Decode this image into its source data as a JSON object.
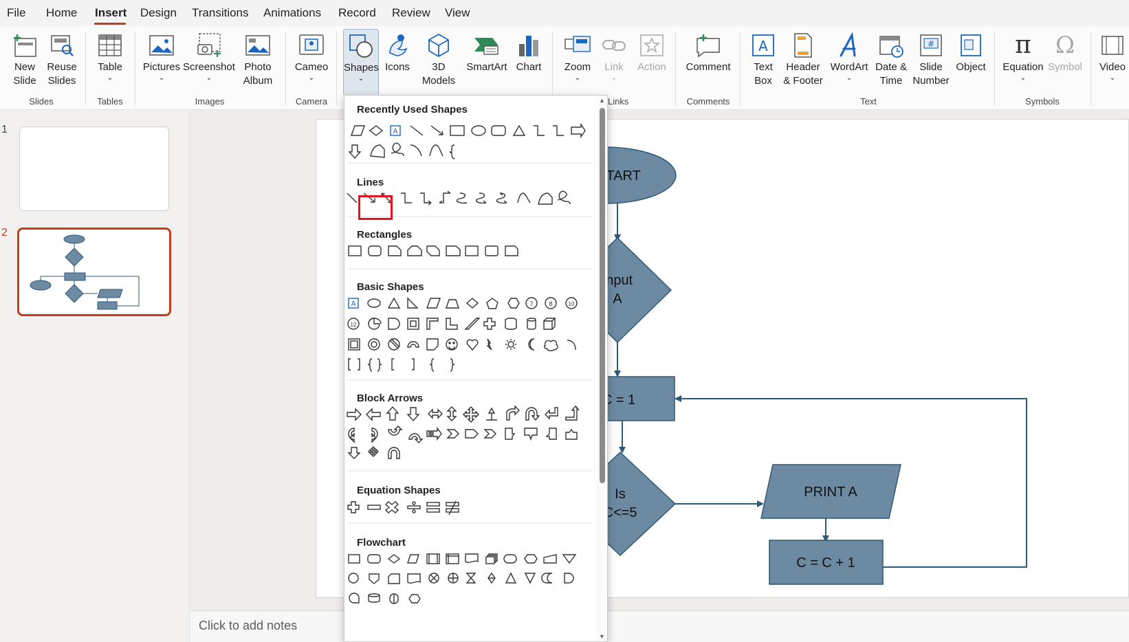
{
  "menu": [
    "File",
    "Home",
    "Insert",
    "Design",
    "Transitions",
    "Animations",
    "Record",
    "Review",
    "View"
  ],
  "active_menu": "Insert",
  "ribbon": {
    "buttons": {
      "new_slide": "New\nSlide",
      "reuse_slides": "Reuse\nSlides",
      "table": "Table",
      "pictures": "Pictures",
      "screenshot": "Screenshot",
      "photo_album": "Photo\nAlbum",
      "cameo": "Cameo",
      "shapes": "Shapes",
      "icons": "Icons",
      "models_3d": "3D\nModels",
      "smartart": "SmartArt",
      "chart": "Chart",
      "zoom": "Zoom",
      "link": "Link",
      "action": "Action",
      "comment": "Comment",
      "text_box": "Text\nBox",
      "header_footer": "Header\n& Footer",
      "wordart": "WordArt",
      "date_time": "Date &\nTime",
      "slide_number": "Slide\nNumber",
      "object": "Object",
      "equation": "Equation",
      "symbol": "Symbol",
      "video": "Video"
    },
    "groups": {
      "slides": "Slides",
      "tables": "Tables",
      "images": "Images",
      "camera": "Camera",
      "links": "Links",
      "comments": "Comments",
      "text": "Text",
      "symbols": "Symbols"
    }
  },
  "slides": {
    "numbers": [
      "1",
      "2"
    ],
    "current": "2"
  },
  "flowchart": {
    "start": "START",
    "input": [
      "Input",
      "A"
    ],
    "assign": "C = 1",
    "decision": [
      "Is",
      "C<=5"
    ],
    "print": "PRINT A",
    "increment": "C = C + 1"
  },
  "shapes_gallery": {
    "sections": [
      "Recently Used Shapes",
      "Lines",
      "Rectangles",
      "Basic Shapes",
      "Block Arrows",
      "Equation Shapes",
      "Flowchart"
    ],
    "selected_shape": "arrow-line"
  },
  "notes_placeholder": "Click to add notes",
  "colors": {
    "accent": "#c43e1c",
    "shape_fill": "#6d8aa3",
    "shape_stroke": "#2e5877",
    "highlight": "#e81123"
  }
}
